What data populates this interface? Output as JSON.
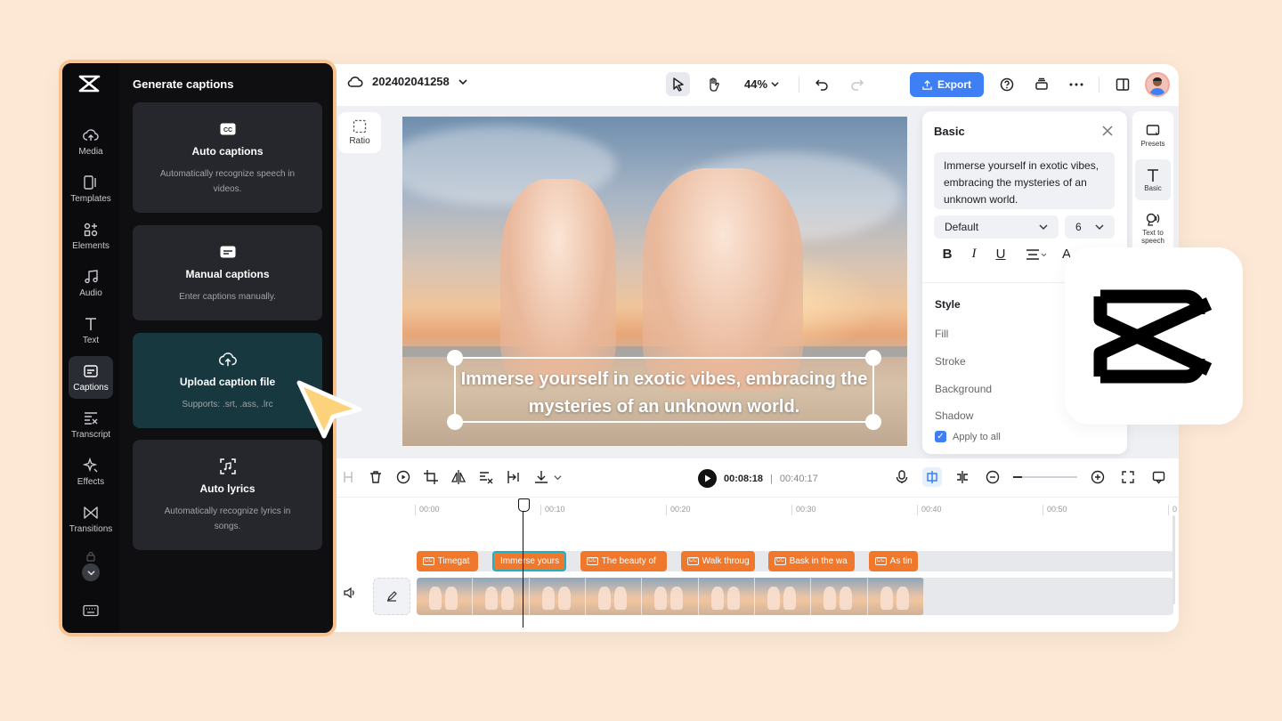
{
  "project": {
    "name": "202402041258"
  },
  "toolbar": {
    "zoom": "44%",
    "export_label": "Export"
  },
  "workspace": {
    "ratio_label": "Ratio",
    "caption_text": "Immerse yourself in exotic vibes, embracing the mysteries of an unknown world."
  },
  "basic_panel": {
    "title": "Basic",
    "text_value": "Immerse yourself in exotic vibes, embracing the mysteries of an unknown world.",
    "font_select": "Default",
    "size_select": "6",
    "style_title": "Style",
    "style_items": [
      "Fill",
      "Stroke",
      "Background",
      "Shadow"
    ],
    "apply_all_label": "Apply to all"
  },
  "right_rail": {
    "items": [
      {
        "label": "Presets"
      },
      {
        "label": "Basic"
      },
      {
        "label": "Text to speech"
      }
    ]
  },
  "timeline": {
    "current_time": "00:08:18",
    "total_time": "00:40:17",
    "ruler_ticks": [
      "00:00",
      "00:10",
      "00:20",
      "00:30",
      "00:40",
      "00:50",
      "0"
    ],
    "caption_clips": [
      {
        "label": "Timegat"
      },
      {
        "label": "Immerse yours"
      },
      {
        "label": "The beauty of"
      },
      {
        "label": "Walk throug"
      },
      {
        "label": "Bask in the wa"
      },
      {
        "label": "As tin"
      }
    ]
  },
  "sidebar": {
    "items": [
      {
        "label": "Media"
      },
      {
        "label": "Templates"
      },
      {
        "label": "Elements"
      },
      {
        "label": "Audio"
      },
      {
        "label": "Text"
      },
      {
        "label": "Captions"
      },
      {
        "label": "Transcript"
      },
      {
        "label": "Effects"
      },
      {
        "label": "Transitions"
      }
    ]
  },
  "captions_panel": {
    "title": "Generate captions",
    "cards": [
      {
        "title": "Auto captions",
        "desc": "Automatically recognize speech in videos."
      },
      {
        "title": "Manual captions",
        "desc": "Enter captions manually."
      },
      {
        "title": "Upload caption file",
        "desc": "Supports: .srt, .ass, .lrc"
      },
      {
        "title": "Auto lyrics",
        "desc": "Automatically recognize lyrics in songs."
      }
    ]
  },
  "colors": {
    "background": "#fde8d6",
    "accent_blue": "#3f7ff5",
    "clip_orange": "#f0782d",
    "panel_dark": "#0f0f12",
    "panel_border": "#f8c38f",
    "cursor_yellow": "#fcd27b"
  }
}
